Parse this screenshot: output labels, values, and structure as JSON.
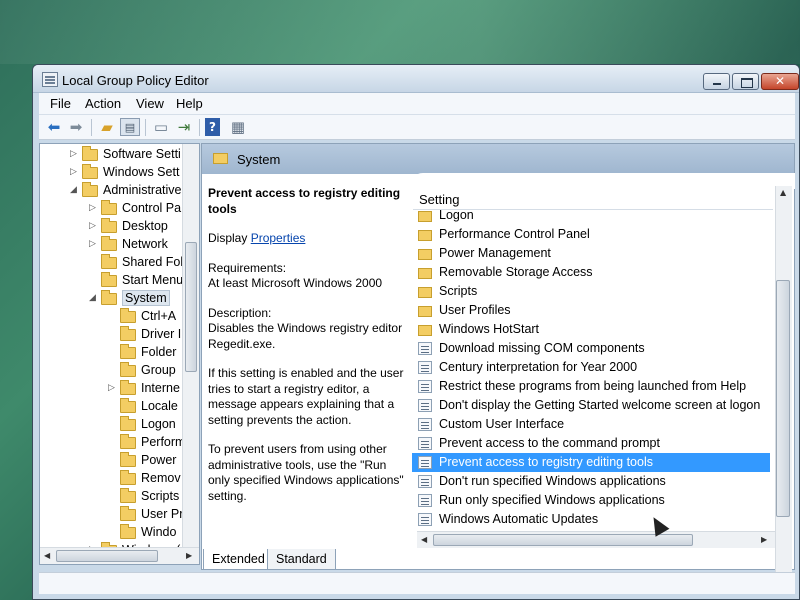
{
  "window": {
    "title": "Local Group Policy Editor"
  },
  "menu": {
    "items": [
      {
        "label": "File"
      },
      {
        "label": "Action"
      },
      {
        "label": "View"
      },
      {
        "label": "Help"
      }
    ]
  },
  "toolbar": {
    "icons": [
      "back-icon",
      "forward-icon",
      "up-folder-icon",
      "show-hide-tree-icon",
      "properties-icon",
      "export-list-icon",
      "help-icon",
      "filter-icon"
    ]
  },
  "tree": {
    "items": [
      {
        "label": "Software Setti",
        "expander": "▷"
      },
      {
        "label": "Windows Sett",
        "expander": "▷"
      },
      {
        "label": "Administrative",
        "expander": "◢"
      },
      {
        "label": "Control Pa",
        "expander": "▷"
      },
      {
        "label": "Desktop",
        "expander": "▷"
      },
      {
        "label": "Network",
        "expander": "▷"
      },
      {
        "label": "Shared Fol",
        "expander": ""
      },
      {
        "label": "Start Menu",
        "expander": ""
      },
      {
        "label": "System",
        "expander": "◢"
      },
      {
        "label": "Ctrl+A",
        "expander": ""
      },
      {
        "label": "Driver I",
        "expander": ""
      },
      {
        "label": "Folder",
        "expander": ""
      },
      {
        "label": "Group",
        "expander": ""
      },
      {
        "label": "Interne",
        "expander": "▷"
      },
      {
        "label": "Locale",
        "expander": ""
      },
      {
        "label": "Logon",
        "expander": ""
      },
      {
        "label": "Perform",
        "expander": ""
      },
      {
        "label": "Power",
        "expander": ""
      },
      {
        "label": "Remov",
        "expander": ""
      },
      {
        "label": "Scripts",
        "expander": ""
      },
      {
        "label": "User Pr",
        "expander": ""
      },
      {
        "label": "Windo",
        "expander": ""
      },
      {
        "label": "Windows (",
        "expander": "▷"
      }
    ]
  },
  "content": {
    "header_title": "System",
    "description": {
      "title": "Prevent access to registry editing tools",
      "display_label": "Display",
      "properties_link": "Properties",
      "requirements_label": "Requirements:",
      "requirements_value": "At least Microsoft Windows 2000",
      "description_label": "Description:",
      "description_text": "Disables the Windows registry editor Regedit.exe.",
      "paragraph_1": "If this setting is enabled and the user tries to start a registry editor, a message appears explaining that a setting prevents the action.",
      "paragraph_2": "To prevent users from using other administrative tools, use the \"Run only specified Windows applications\" setting."
    },
    "list": {
      "column_header": "Setting",
      "rows": [
        {
          "label": "Logon",
          "type": "folder"
        },
        {
          "label": "Performance Control Panel",
          "type": "folder"
        },
        {
          "label": "Power Management",
          "type": "folder"
        },
        {
          "label": "Removable Storage Access",
          "type": "folder"
        },
        {
          "label": "Scripts",
          "type": "folder"
        },
        {
          "label": "User Profiles",
          "type": "folder"
        },
        {
          "label": "Windows HotStart",
          "type": "folder"
        },
        {
          "label": "Download missing COM components",
          "type": "setting"
        },
        {
          "label": "Century interpretation for Year 2000",
          "type": "setting"
        },
        {
          "label": "Restrict these programs from being launched from Help",
          "type": "setting"
        },
        {
          "label": "Don't display the Getting Started welcome screen at logon",
          "type": "setting"
        },
        {
          "label": "Custom User Interface",
          "type": "setting"
        },
        {
          "label": "Prevent access to the command prompt",
          "type": "setting"
        },
        {
          "label": "Prevent access to registry editing tools",
          "type": "setting",
          "selected": true
        },
        {
          "label": "Don't run specified Windows applications",
          "type": "setting"
        },
        {
          "label": "Run only specified Windows applications",
          "type": "setting"
        },
        {
          "label": "Windows Automatic Updates",
          "type": "setting"
        }
      ]
    },
    "tabs": [
      {
        "label": "Extended",
        "active": true
      },
      {
        "label": "Standard",
        "active": false
      }
    ]
  },
  "colors": {
    "selection": "#3399ff",
    "link": "#0645ad",
    "header_band": "#9fb6cf"
  }
}
